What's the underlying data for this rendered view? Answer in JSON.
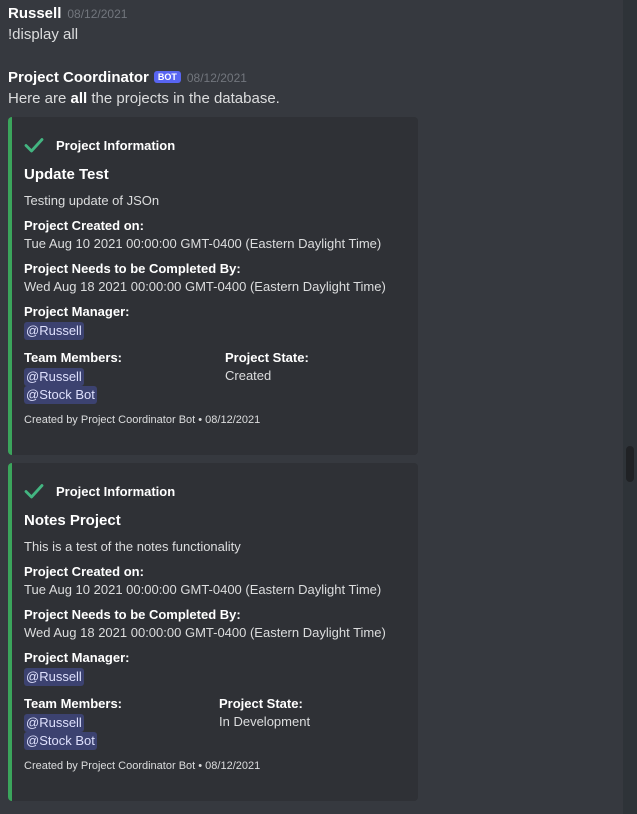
{
  "messages": [
    {
      "author": "Russell",
      "timestamp": "08/12/2021",
      "text": "!display all"
    },
    {
      "author": "Project Coordinator",
      "bot_tag": "BOT",
      "timestamp": "08/12/2021",
      "text_before": "Here are ",
      "text_bold": "all",
      "text_after": " the projects in the database."
    }
  ],
  "embeds": [
    {
      "author_icon": "check-icon",
      "author": "Project Information",
      "title": "Update Test",
      "description": "Testing update of JSOn",
      "created_label": "Project Created on:",
      "created_value": "Tue Aug 10 2021 00:00:00 GMT-0400 (Eastern Daylight Time)",
      "due_label": "Project Needs to be Completed By:",
      "due_value": "Wed Aug 18 2021 00:00:00 GMT-0400 (Eastern Daylight Time)",
      "manager_label": "Project Manager:",
      "manager": "@Russell",
      "team_label": "Team Members:",
      "team": [
        "@Russell",
        "@Stock Bot"
      ],
      "state_label": "Project State:",
      "state": "Created",
      "footer": "Created by Project Coordinator Bot • 08/12/2021"
    },
    {
      "author_icon": "check-icon",
      "author": "Project Information",
      "title": "Notes Project",
      "description": "This is a test of the notes functionality",
      "created_label": "Project Created on:",
      "created_value": "Tue Aug 10 2021 00:00:00 GMT-0400 (Eastern Daylight Time)",
      "due_label": "Project Needs to be Completed By:",
      "due_value": "Wed Aug 18 2021 00:00:00 GMT-0400 (Eastern Daylight Time)",
      "manager_label": "Project Manager:",
      "manager": "@Russell",
      "team_label": "Team Members:",
      "team": [
        "@Russell",
        "@Stock Bot"
      ],
      "state_label": "Project State:",
      "state": "In Development",
      "footer": "Created by Project Coordinator Bot • 08/12/2021"
    }
  ],
  "colors": {
    "embed_accent": "#3ba55c",
    "bot_tag": "#5865f2",
    "mention_bg": "#3c4270"
  }
}
